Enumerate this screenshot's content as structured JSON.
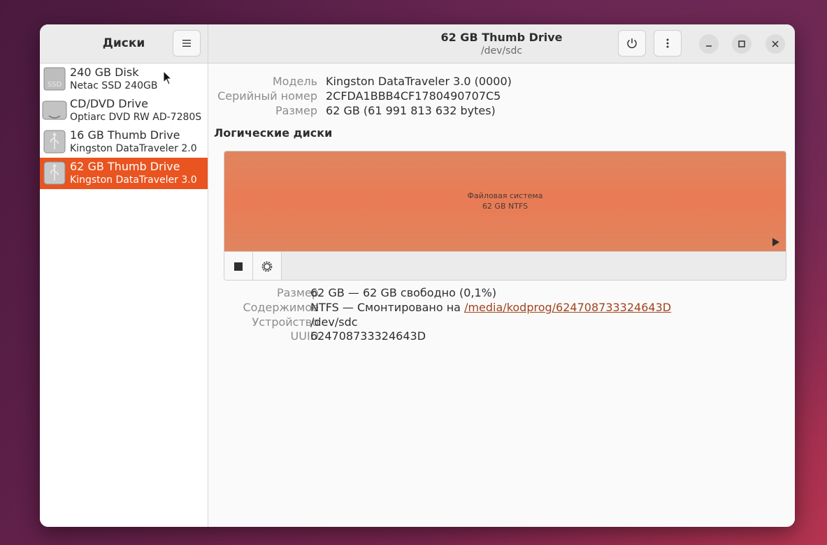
{
  "sidebar": {
    "title": "Диски",
    "drives": [
      {
        "name": "240 GB Disk",
        "model": "Netac SSD 240GB",
        "icon": "ssd-icon",
        "icon_text": "SSD"
      },
      {
        "name": "CD/DVD Drive",
        "model": "Optiarc DVD RW AD-7280S",
        "icon": "optical-drive-icon"
      },
      {
        "name": "16 GB Thumb Drive",
        "model": "Kingston DataTraveler 2.0",
        "icon": "usb-icon"
      },
      {
        "name": "62 GB Thumb Drive",
        "model": "Kingston DataTraveler 3.0",
        "icon": "usb-icon",
        "selected": true
      }
    ]
  },
  "header": {
    "title": "62 GB Thumb Drive",
    "subtitle": "/dev/sdc"
  },
  "drive_info": {
    "model_label": "Модель",
    "model_value": "Kingston DataTraveler 3.0 (0000)",
    "serial_label": "Серийный номер",
    "serial_value": "2CFDA1BBB4CF1780490707C5",
    "size_label": "Размер",
    "size_value": "62 GB (61 991 813 632 bytes)"
  },
  "volumes": {
    "title": "Логические диски",
    "partition_line1": "Файловая система",
    "partition_line2": "62 GB NTFS"
  },
  "volume_info": {
    "size_label": "Размер",
    "size_value": "62 GB — 62 GB свободно (0,1%)",
    "content_label": "Содержимое",
    "content_value": "NTFS — Смонтировано на ",
    "mount_link": "/media/kodprog/624708733324643D",
    "device_label": "Устройство",
    "device_value": "/dev/sdc",
    "uuid_label": "UUID",
    "uuid_value": "624708733324643D"
  },
  "colors": {
    "accent": "#e95420",
    "partition": "#e97b55"
  }
}
